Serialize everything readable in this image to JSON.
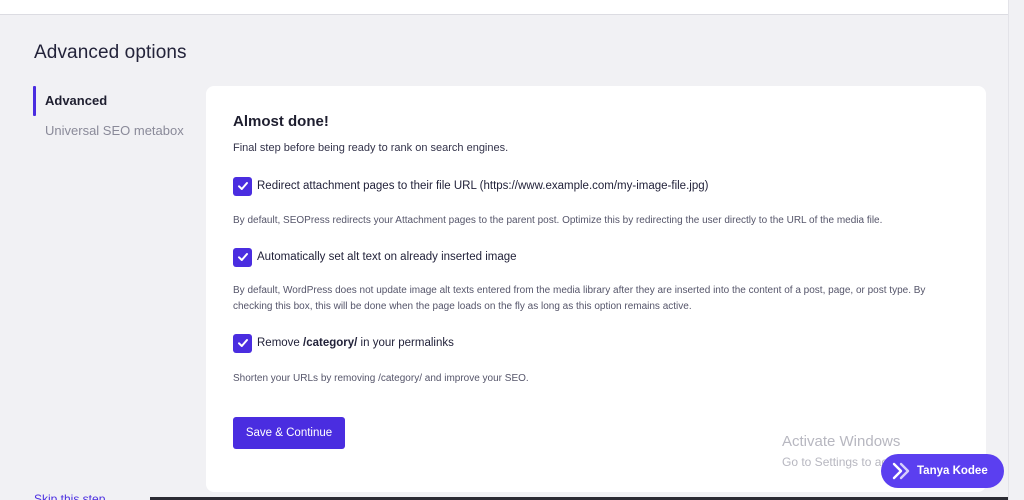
{
  "page": {
    "title": "Advanced options"
  },
  "sidebar": {
    "items": [
      {
        "label": "Advanced",
        "active": true
      },
      {
        "label": "Universal SEO metabox",
        "active": false
      }
    ],
    "skip_link": "Skip this step"
  },
  "card": {
    "title": "Almost done!",
    "subtitle": "Final step before being ready to rank on search engines.",
    "options": [
      {
        "label": "Redirect attachment pages to their file URL (https://www.example.com/my-image-file.jpg)",
        "checked": true,
        "description": "By default, SEOPress redirects your Attachment pages to the parent post. Optimize this by redirecting the user directly to the URL of the media file."
      },
      {
        "label": "Automatically set alt text on already inserted image",
        "checked": true,
        "description": "By default, WordPress does not update image alt texts entered from the media library after they are inserted into the content of a post, page, or post type. By checking this box, this will be done when the page loads on the fly as long as this option remains active."
      },
      {
        "label_prefix": "Remove ",
        "label_bold": "/category/",
        "label_suffix": " in your permalinks",
        "checked": true,
        "description": "Shorten your URLs by removing /category/ and improve your SEO."
      }
    ],
    "save_label": "Save & Continue"
  },
  "watermark": {
    "title": "Activate Windows",
    "subtitle": "Go to Settings to activate Windows."
  },
  "user_badge": {
    "name": "Tanya Kodee",
    "icon": "lightning-logo-icon"
  },
  "icons": {
    "checkbox": "checkmark-icon"
  },
  "colors": {
    "accent": "#4a2de0",
    "badge": "#5b3ff0",
    "background": "#f1f1f4",
    "card": "#ffffff"
  }
}
